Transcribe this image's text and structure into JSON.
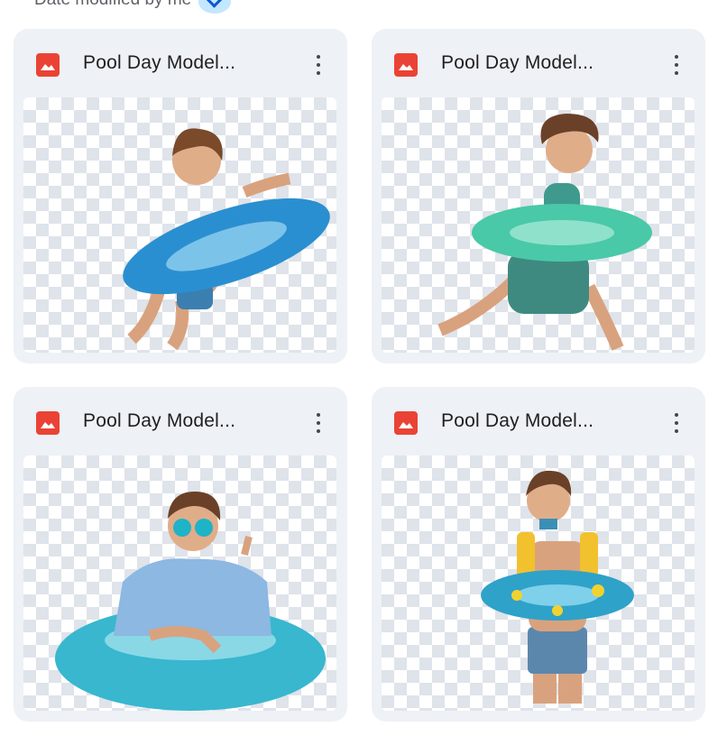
{
  "sort": {
    "label": "Date modified by me"
  },
  "files": [
    {
      "name": "Pool Day Model...",
      "icon": "image-file-icon",
      "menu_icon": "more-vert-icon"
    },
    {
      "name": "Pool Day Model...",
      "icon": "image-file-icon",
      "menu_icon": "more-vert-icon"
    },
    {
      "name": "Pool Day Model...",
      "icon": "image-file-icon",
      "menu_icon": "more-vert-icon"
    },
    {
      "name": "Pool Day Model...",
      "icon": "image-file-icon",
      "menu_icon": "more-vert-icon"
    }
  ],
  "colors": {
    "card_bg": "#eef1f6",
    "image_icon": "#ea4335",
    "sort_chip": "#c2e7ff"
  }
}
